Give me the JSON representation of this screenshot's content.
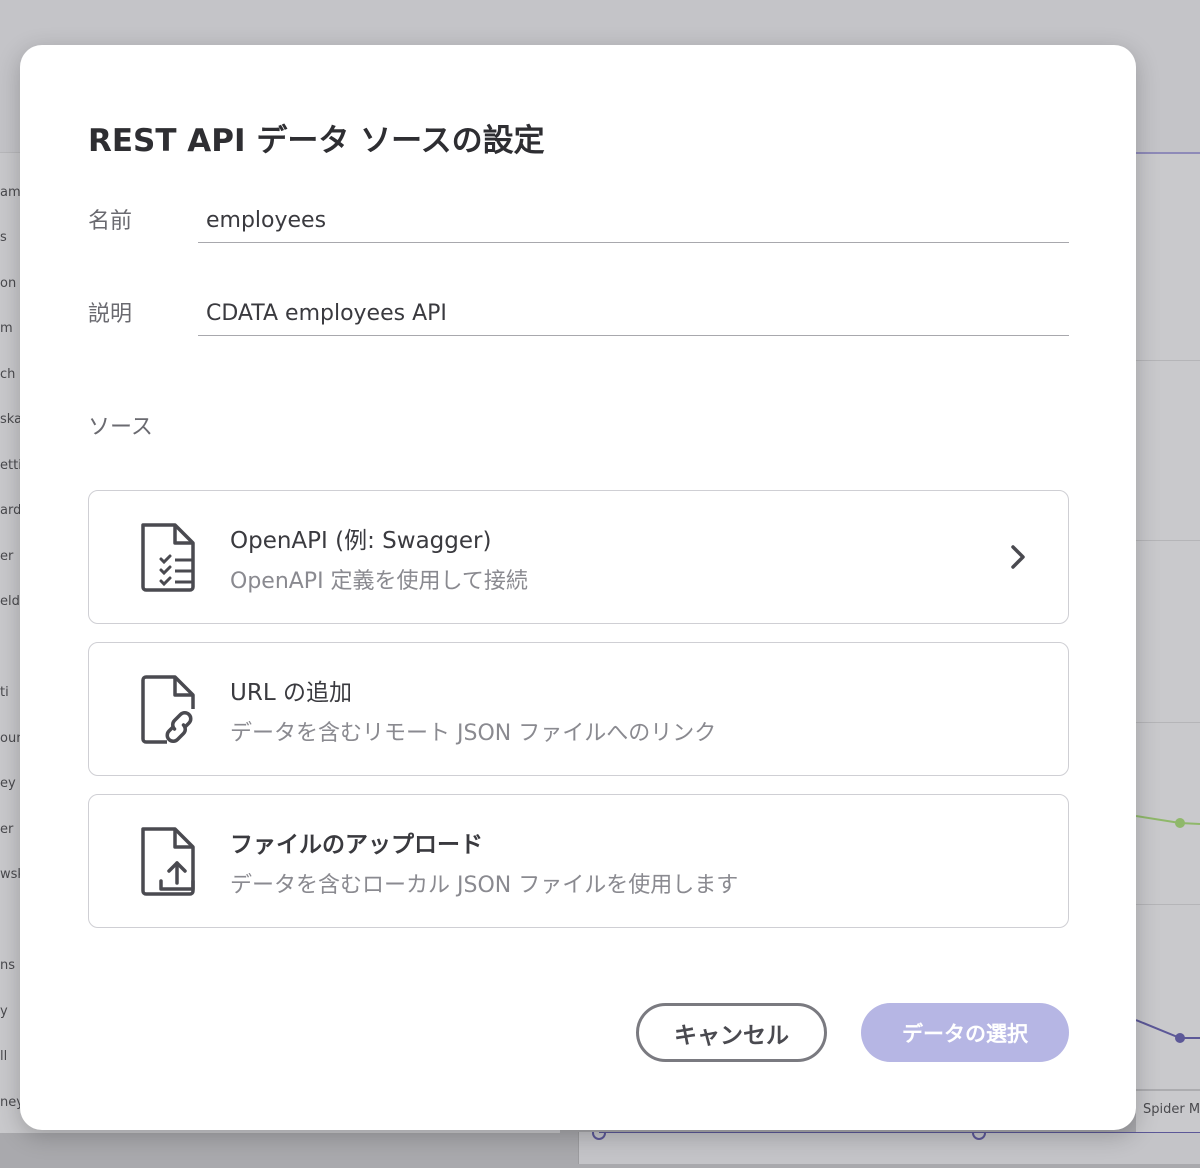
{
  "background": {
    "left_list": [
      "ame",
      "s",
      "on",
      "m",
      "ch",
      "ska",
      "etti",
      "ard",
      "er",
      "eld",
      "ti",
      "oun",
      "ey",
      "er",
      "wsk",
      "ns",
      "y",
      "ll",
      "ney"
    ],
    "chart_label": "Spider M"
  },
  "dialog": {
    "title": "REST API データ ソースの設定",
    "name_label": "名前",
    "name_value": "employees",
    "description_label": "説明",
    "description_value": "CDATA employees API",
    "source_label": "ソース",
    "options": [
      {
        "title": "OpenAPI (例: Swagger)",
        "subtitle": "OpenAPI 定義を使用して接続",
        "icon": "document-checklist-icon"
      },
      {
        "title": "URL の追加",
        "subtitle": "データを含むリモート JSON ファイルへのリンク",
        "icon": "document-link-icon"
      },
      {
        "title": "ファイルのアップロード",
        "subtitle": "データを含むローカル JSON ファイルを使用します",
        "icon": "document-upload-icon"
      }
    ],
    "cancel_label": "キャンセル",
    "select_label": "データの選択"
  }
}
